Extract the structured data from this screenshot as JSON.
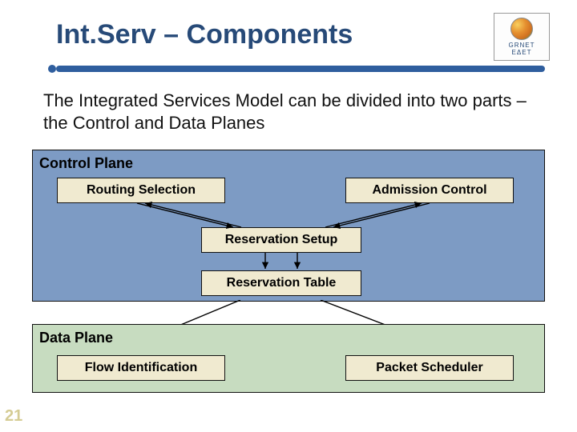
{
  "title": "Int.Serv – Components",
  "logo": {
    "line1": "GRNET",
    "line2": "ΕΔΕΤ"
  },
  "intro": "The Integrated Services Model can be divided into two parts – the Control and Data Planes",
  "diagram": {
    "control": {
      "label": "Control Plane",
      "nodes": {
        "routing": "Routing Selection",
        "admission": "Admission Control",
        "resv_setup": "Reservation Setup",
        "resv_table": "Reservation Table"
      }
    },
    "data": {
      "label": "Data Plane",
      "nodes": {
        "flow_id": "Flow Identification",
        "scheduler": "Packet Scheduler"
      }
    },
    "edges": [
      {
        "from": "routing",
        "to": "resv_setup",
        "bidir": true
      },
      {
        "from": "admission",
        "to": "resv_setup",
        "bidir": true
      },
      {
        "from": "resv_setup",
        "to": "resv_table",
        "bidir": false
      },
      {
        "from": "resv_table",
        "to": "flow_id",
        "bidir": false
      },
      {
        "from": "resv_table",
        "to": "scheduler",
        "bidir": false
      }
    ]
  },
  "slide_number": "21",
  "colors": {
    "title": "#274a78",
    "rule": "#2f5e9e",
    "control_plane_bg": "#7d9bc4",
    "data_plane_bg": "#c7dcc0",
    "node_bg": "#f0ead0",
    "slide_number": "#d5cc94"
  }
}
